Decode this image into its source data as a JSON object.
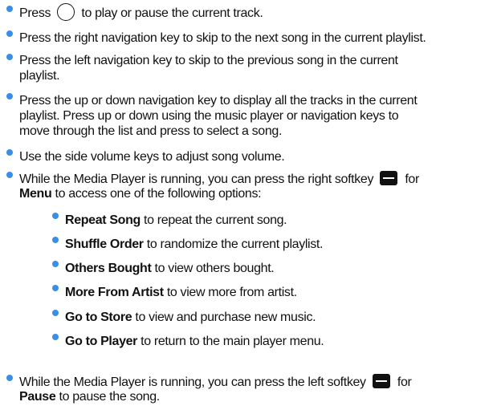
{
  "bullets": [
    {
      "pre": "Press",
      "post": "to play or pause the current track.",
      "icon": "circle-icon"
    },
    {
      "text": "Press the right navigation key to skip to the next song in the current playlist."
    },
    {
      "lines": [
        "Press the left navigation key to skip to the previous song in the current",
        "playlist."
      ]
    },
    {
      "lines": [
        "Press the up or down navigation key to display all the tracks in the current",
        "playlist. Press up or down using the music player or navigation keys to",
        "move through the list and press to select a song."
      ]
    },
    {
      "text": "Use the side volume keys to adjust song volume."
    },
    {
      "pre": "While the Media Player is running, you can press the right softkey",
      "post": "for",
      "icon": "softkey-icon",
      "line2_bold": "Menu",
      "line2_rest": " to access one of the following options:"
    },
    {
      "pre": "While the Media Player is running, you can press the left softkey",
      "post": "for",
      "icon": "softkey-icon",
      "line2_bold": "Pause",
      "line2_rest": " to pause the song."
    }
  ],
  "menu_options": [
    {
      "name": "Repeat Song",
      "desc": " to repeat the current song."
    },
    {
      "name": "Shuffle Order",
      "desc": " to randomize the current playlist."
    },
    {
      "name": "Others Bought",
      "desc": " to view others bought."
    },
    {
      "name": "More From Artist",
      "desc": " to view more from artist."
    },
    {
      "name": "Go to Store",
      "desc": " to view and purchase new music."
    },
    {
      "name": "Go to Player",
      "desc": " to return to the main player menu."
    }
  ],
  "colors": {
    "bullet": "#3a8ee6",
    "text": "#111111"
  }
}
